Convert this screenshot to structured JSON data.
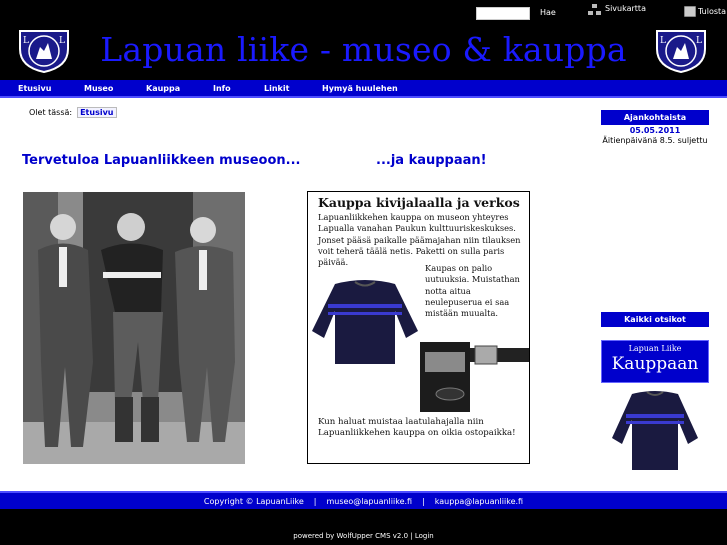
{
  "header": {
    "search_button": "Hae",
    "sitemap_label": "Sivukartta",
    "print_label": "Tulosta",
    "title": "Lapuan liike - museo & kauppa",
    "logo_letter_left": "L",
    "logo_letter_right": "L"
  },
  "nav": {
    "items": [
      {
        "label": "Etusivu"
      },
      {
        "label": "Museo"
      },
      {
        "label": "Kauppa"
      },
      {
        "label": "Info"
      },
      {
        "label": "Linkit"
      },
      {
        "label": "Hymyä huulehen"
      }
    ]
  },
  "breadcrumb": {
    "prefix": "Olet tässä:",
    "current": "Etusivu"
  },
  "main": {
    "welcome_left": "Tervetuloa Lapuanliikkeen museoon...",
    "welcome_right": "...ja kauppaan!",
    "ad": {
      "title": "Kauppa kivijalaalla ja verkos",
      "text1": "Lapuanliikkehen kauppa on museon yhteyres Lapualla vanahan Paukun kulttuuriskeskukses. Jonset pääsä paikalle päämajahan niin tilauksen voit teherä täälä netis. Paketti on sulla paris päivää.",
      "text2": "Kaupas on palio uutuuksia. Muistathan notta aitua neulepuserua ei saa mistään muualta.",
      "text3": "Kun haluat muistaa laatulahajalla niin Lapuanliikkehen kauppa on oikia ostopaikka!"
    }
  },
  "sidebar": {
    "news_heading": "Ajankohtaista",
    "news_date": "05.05.2011",
    "news_text": "Äitienpäivänä 8.5. suljettu",
    "all_headlines": "Kaikki otsikot",
    "shop_banner_small": "Lapuan Liike",
    "shop_banner_big": "Kauppaan"
  },
  "footer": {
    "copyright": "Copyright © LapuanLiike",
    "sep1": "|",
    "email1": "museo@lapuanliike.fi",
    "sep2": "|",
    "email2": "kauppa@lapuanliike.fi",
    "powered": "powered by WolfUpper CMS v2.0 | Login"
  },
  "colors": {
    "brand_blue": "#0000cc",
    "title_blue": "#1a1aff",
    "background": "#000000"
  }
}
